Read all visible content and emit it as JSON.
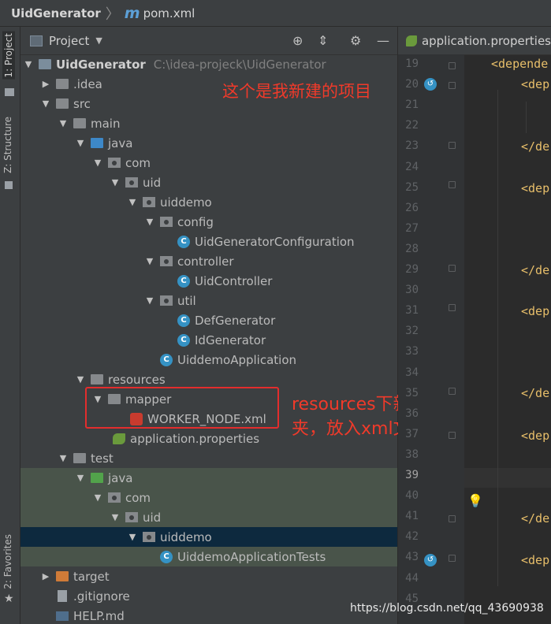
{
  "breadcrumb": {
    "project": "UidGenerator",
    "file": "pom.xml",
    "file_icon": "m"
  },
  "left_strip": {
    "project_tab": "1: Project",
    "structure_tab": "Z: Structure",
    "favorites_tab": "2: Favorites"
  },
  "panel": {
    "title": "Project"
  },
  "tree": {
    "root_name": "UidGenerator",
    "root_path": "C:\\idea-projeck\\UidGenerator",
    "idea": ".idea",
    "src": "src",
    "main": "main",
    "java": "java",
    "com": "com",
    "uid": "uid",
    "uiddemo": "uiddemo",
    "config": "config",
    "cfg_class": "UidGeneratorConfiguration",
    "controller": "controller",
    "ctrl_class": "UidController",
    "util": "util",
    "def_gen": "DefGenerator",
    "id_gen": "IdGenerator",
    "app_class": "UiddemoApplication",
    "resources": "resources",
    "mapper": "mapper",
    "worker_xml": "WORKER_NODE.xml",
    "app_props": "application.properties",
    "test": "test",
    "test_java": "java",
    "test_com": "com",
    "test_uid": "uid",
    "test_uiddemo": "uiddemo",
    "test_class": "UiddemoApplicationTests",
    "target": "target",
    "gitignore": ".gitignore",
    "help": "HELP.md"
  },
  "annotations": {
    "note1": "这个是我新建的项目",
    "note2": "resources下新建mapper文件夹，放入xml文件"
  },
  "editor": {
    "tab": "application.properties",
    "line_numbers": [
      "19",
      "20",
      "21",
      "22",
      "23",
      "24",
      "25",
      "26",
      "27",
      "28",
      "29",
      "30",
      "31",
      "32",
      "33",
      "34",
      "35",
      "36",
      "37",
      "38",
      "39",
      "40",
      "41",
      "42",
      "43",
      "44",
      "45"
    ],
    "code": {
      "l19": "<depende",
      "l20": "<dep",
      "l23": "</de",
      "l25": "<dep",
      "l29": "</de",
      "l31": "<dep",
      "l35": "</de",
      "l37": "<dep",
      "l41": "</de",
      "l43": "<dep"
    }
  },
  "watermark": "https://blog.csdn.net/qq_43690938"
}
